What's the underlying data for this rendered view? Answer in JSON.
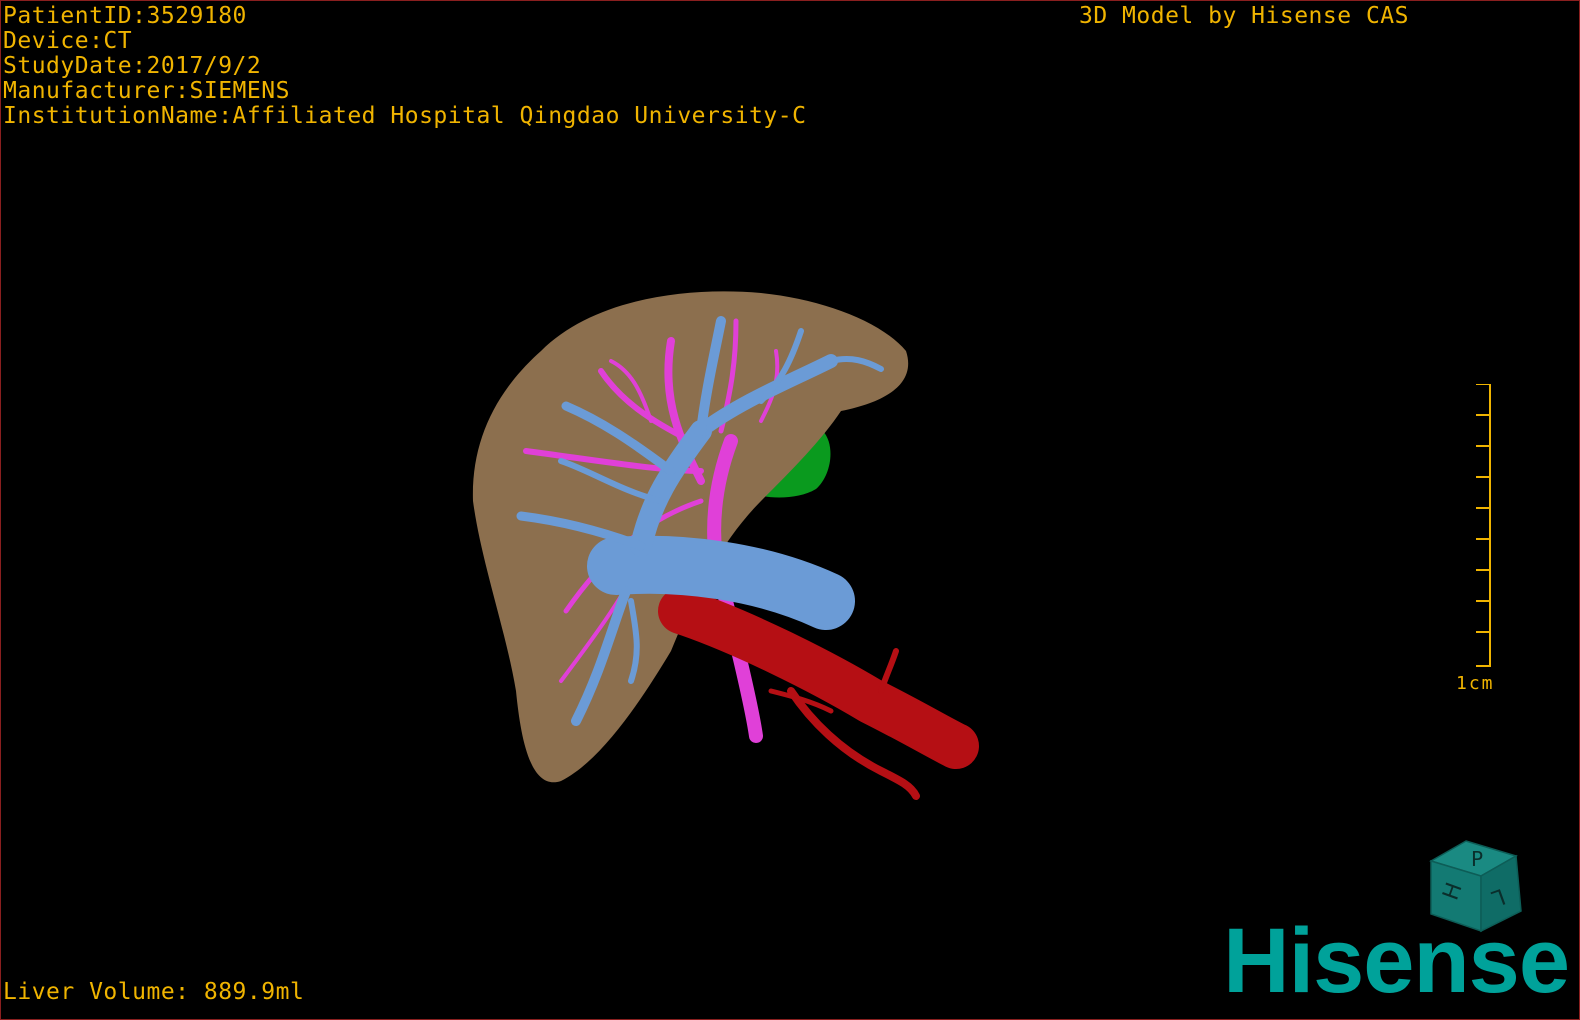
{
  "info": {
    "patient_id": "PatientID:3529180",
    "device": "Device:CT",
    "study_date": "StudyDate:2017/9/2",
    "manufacturer": "Manufacturer:SIEMENS",
    "institution": "InstitutionName:Affiliated Hospital Qingdao University-C"
  },
  "credit": "3D Model by Hisense CAS",
  "volume": "Liver Volume: 889.9ml",
  "scale": {
    "label": "1cm"
  },
  "cube": {
    "face_top": "P",
    "face_left": "H",
    "face_right": "L"
  },
  "brand": {
    "logo": "Hisense"
  },
  "colors": {
    "text": "#f0b400",
    "liver": "#8c6f4e",
    "hepatic_vein": "#6b9bd6",
    "portal_vein": "#e040d8",
    "artery": "#b50f14",
    "gallbladder": "#0a9a1e",
    "logo": "#00a29a"
  }
}
